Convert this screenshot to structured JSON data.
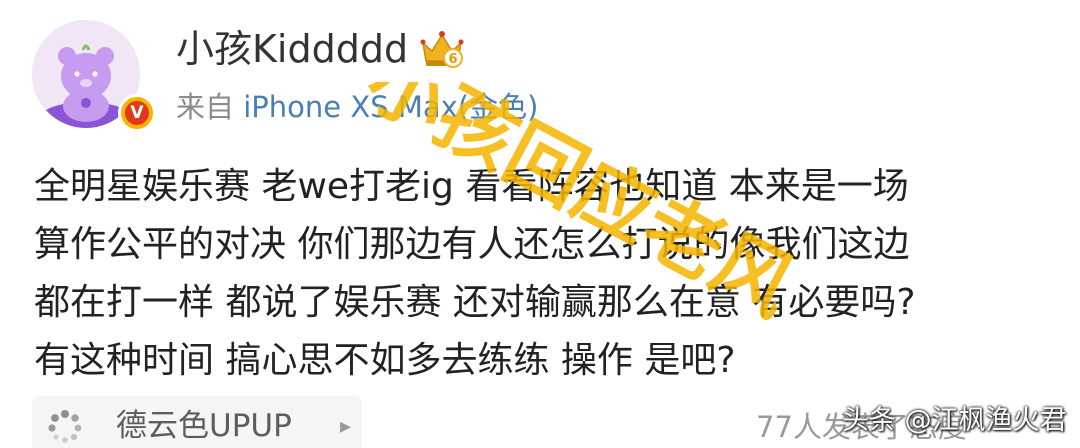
{
  "post": {
    "author": {
      "name": "小孩Kiddddd",
      "avatar_icon": "purple-bear-avatar",
      "verified_badge_letter": "V",
      "vip_icon": "gold-crown-level-icon",
      "vip_level": "6"
    },
    "source": {
      "prefix": "来自",
      "device": "iPhone XS Max(金色)"
    },
    "content_lines": [
      "全明星娱乐赛 老we打老ig 看看阵容也知道 本来是一场",
      "算作公平的对决 你们那边有人还怎么打说的像我们这边",
      "都在打一样 都说了娱乐赛 还对输赢那么在意 有必要吗?",
      "有这种时间 搞心思不如多去练练 操作 是吧?"
    ],
    "overlay_caption": "小孩回应老风",
    "topic": {
      "label": "德云色UPUP",
      "icon": "loading-spinner-icon",
      "arrow_icon": "chevron-right-icon"
    },
    "engagement_text": "77人发表了态度",
    "attribution": "头条 @江枫渔火君"
  },
  "colors": {
    "link": "#4a7fb5",
    "text": "#222222",
    "meta": "#8c8c8c",
    "watermark": "#f5b400",
    "badge_red": "#e03a1e",
    "badge_gold": "#fbb300"
  }
}
